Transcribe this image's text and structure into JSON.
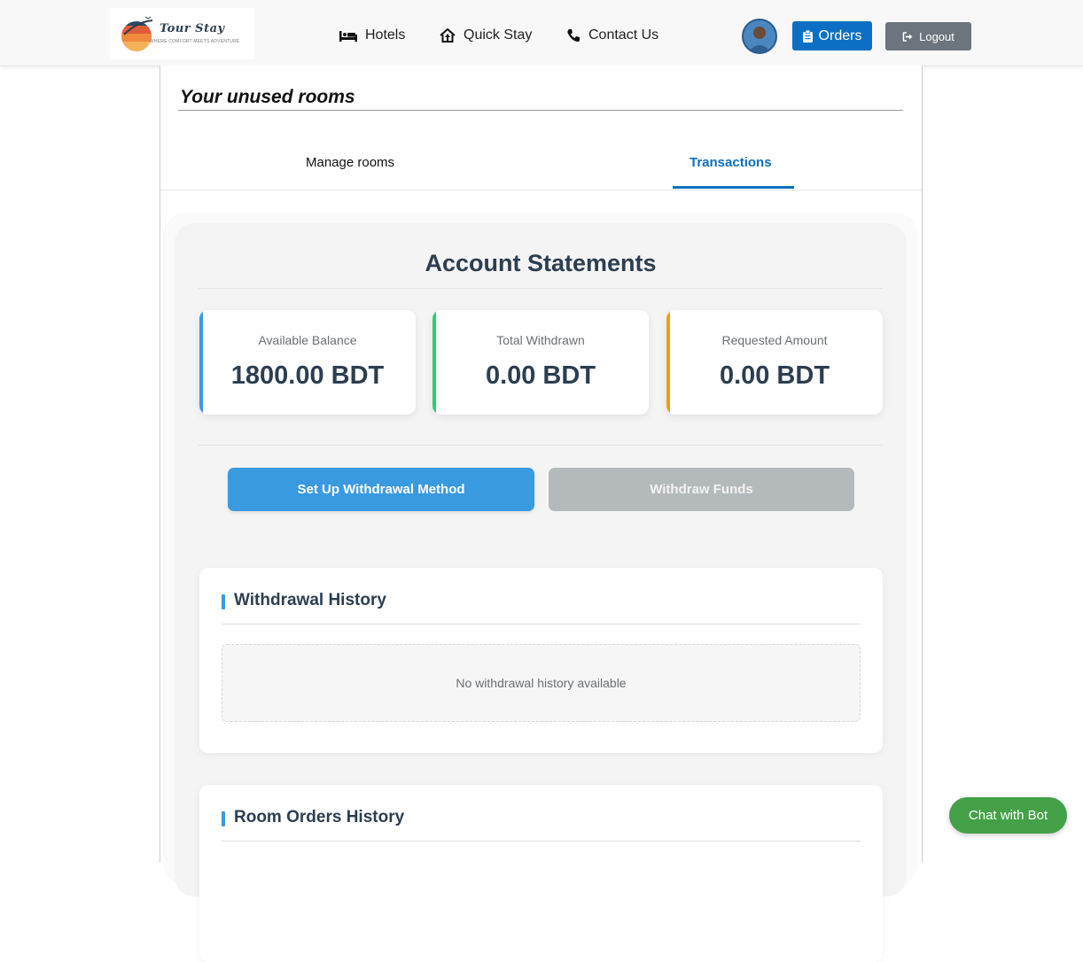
{
  "brand": {
    "title": "Tour Stay",
    "tagline": "WHERE COMFORT MEETS ADVENTURE"
  },
  "nav": {
    "links": [
      {
        "label": "Hotels",
        "icon": "bed-icon"
      },
      {
        "label": "Quick Stay",
        "icon": "house-icon"
      },
      {
        "label": "Contact Us",
        "icon": "phone-icon"
      }
    ],
    "orders_label": "Orders",
    "logout_label": "Logout"
  },
  "page": {
    "heading": "Your unused rooms",
    "tabs": [
      {
        "label": "Manage rooms",
        "active": false
      },
      {
        "label": "Transactions",
        "active": true
      }
    ]
  },
  "statements": {
    "title": "Account Statements",
    "stats": [
      {
        "label": "Available Balance",
        "value": "1800.00 BDT",
        "color": "#3a9ae0"
      },
      {
        "label": "Total Withdrawn",
        "value": "0.00 BDT",
        "color": "#2ecc71"
      },
      {
        "label": "Requested Amount",
        "value": "0.00 BDT",
        "color": "#f39c12"
      }
    ],
    "setup_button": "Set Up Withdrawal Method",
    "withdraw_button": "Withdraw Funds",
    "withdrawal_history": {
      "title": "Withdrawal History",
      "empty_text": "No withdrawal history available"
    },
    "room_orders_history": {
      "title": "Room Orders History"
    }
  },
  "chat": {
    "label": "Chat with Bot"
  },
  "colors": {
    "primary": "#0d6fc3",
    "accent": "#3a9ae0",
    "heading": "#2c3e50",
    "chat": "#43a047"
  }
}
